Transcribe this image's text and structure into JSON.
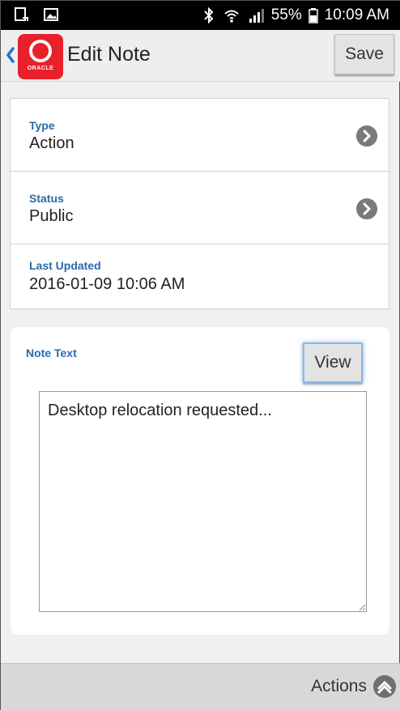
{
  "status_bar": {
    "left_icons": [
      "screen-icon",
      "image-icon"
    ],
    "right_icons": [
      "bluetooth-icon",
      "wifi-icon",
      "signal-icon",
      "battery-icon"
    ],
    "battery": "55%",
    "time": "10:09 AM"
  },
  "header": {
    "back_icon": "chevron-left-icon",
    "logo_text": "ORACLE",
    "title": "Edit Note",
    "save_label": "Save"
  },
  "fields": [
    {
      "label": "Type",
      "value": "Action",
      "has_chevron": true
    },
    {
      "label": "Status",
      "value": "Public",
      "has_chevron": true
    },
    {
      "label": "Last Updated",
      "value": "2016-01-09 10:06 AM",
      "has_chevron": false
    }
  ],
  "note": {
    "label": "Note Text",
    "view_label": "View",
    "text": "Desktop relocation requested..."
  },
  "footer": {
    "actions_label": "Actions",
    "actions_icon": "chevron-up-circle-icon"
  },
  "colors": {
    "label_blue": "#2a6aa8",
    "brand_red": "#e8202a",
    "back_blue": "#1e73c8"
  }
}
